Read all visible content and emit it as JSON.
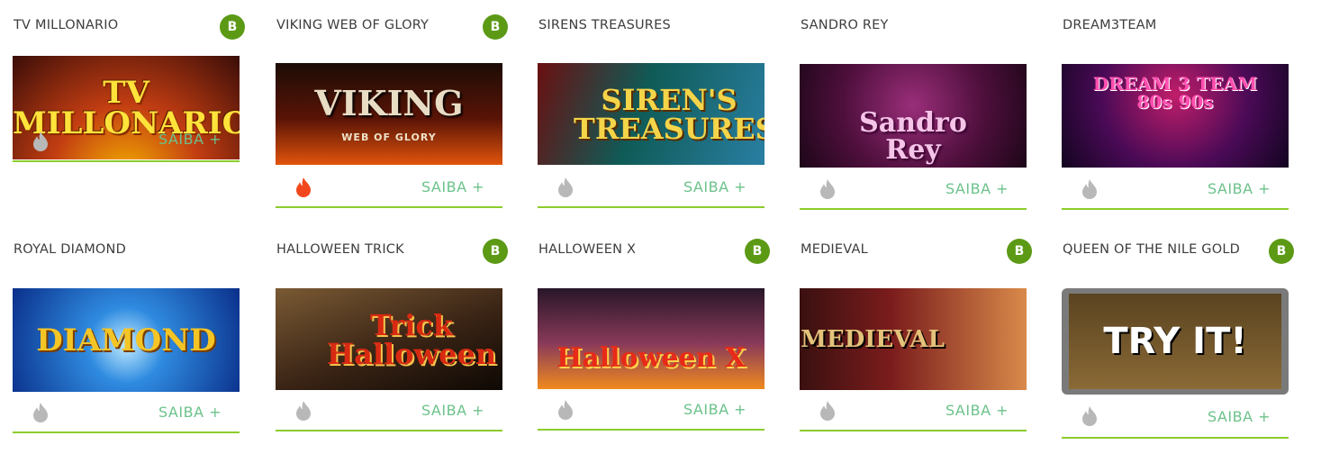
{
  "colors": {
    "badge_bg": "#5c9a16",
    "link_text": "#6cc28a",
    "underline": "#8ccc2c",
    "flame_inactive": "#b8b8b8",
    "flame_active": "#f2471d"
  },
  "games": [
    {
      "title": "TV MILLONARIO",
      "badge": "B",
      "thumb_text": "TV\nMILLONARIO",
      "link": "SAIBA +",
      "hot": false
    },
    {
      "title": "VIKING WEB OF GLORY",
      "badge": "B",
      "thumb_text": "VIKING",
      "thumb_sub": "WEB OF GLORY",
      "link": "SAIBA +",
      "hot": true
    },
    {
      "title": "SIRENS TREASURES",
      "badge": null,
      "thumb_text": "SIREN'S\nTREASURES",
      "link": "SAIBA +",
      "hot": false
    },
    {
      "title": "SANDRO REY",
      "badge": null,
      "thumb_text": "Sandro\nRey",
      "link": "SAIBA +",
      "hot": false
    },
    {
      "title": "DREAM3TEAM",
      "badge": null,
      "thumb_text": "DREAM 3 TEAM\n80s 90s",
      "link": "SAIBA +",
      "hot": false
    },
    {
      "title": "ROYAL DIAMOND",
      "badge": null,
      "thumb_text": "DIAMOND",
      "link": "SAIBA +",
      "hot": false
    },
    {
      "title": "HALLOWEEN TRICK",
      "badge": "B",
      "thumb_text": "Trick\nHalloween",
      "link": "SAIBA +",
      "hot": false
    },
    {
      "title": "HALLOWEEN X",
      "badge": "B",
      "thumb_text": "Halloween X",
      "link": "SAIBA +",
      "hot": false
    },
    {
      "title": "MEDIEVAL",
      "badge": "B",
      "thumb_text": "MEDIEVAL",
      "link": "SAIBA +",
      "hot": false
    },
    {
      "title": "QUEEN OF THE NILE GOLD",
      "badge": "B",
      "thumb_text": "TRY IT!",
      "link": "SAIBA +",
      "hot": false
    }
  ]
}
